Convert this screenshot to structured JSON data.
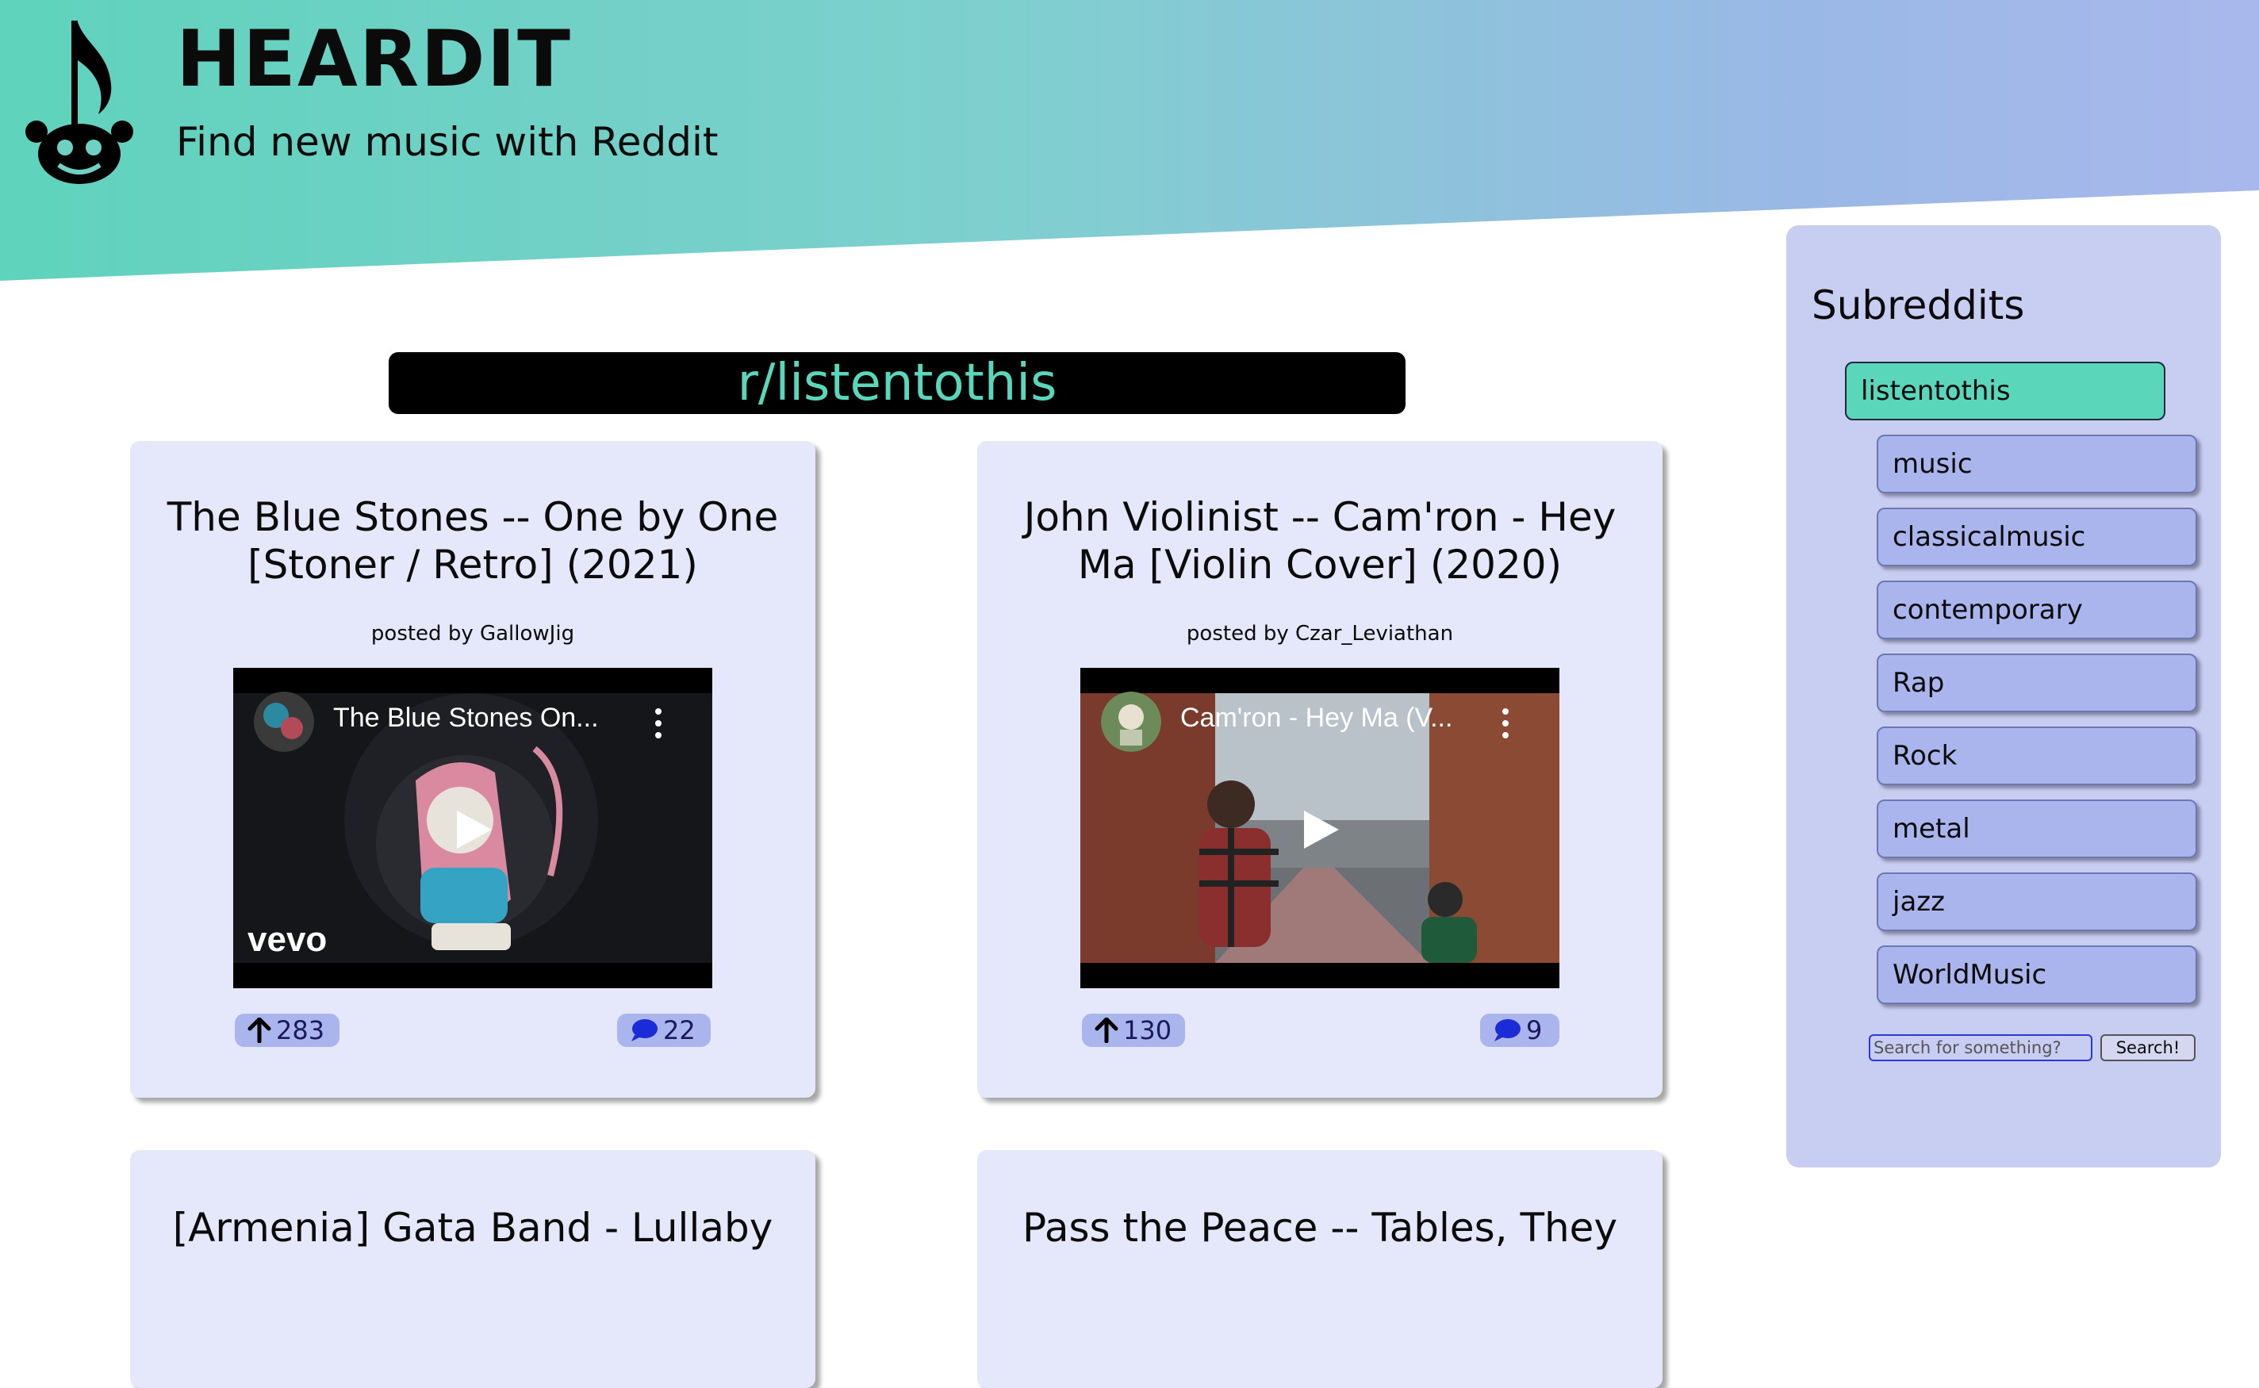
{
  "header": {
    "title": "HEARDIT",
    "subtitle": "Find new music with Reddit",
    "logo_icon": "music-note-reddit-logo-icon"
  },
  "main": {
    "current_subreddit": "r/listentothis",
    "posts": [
      {
        "title": "The Blue Stones -- One by One [Stoner / Retro] (2021)",
        "author": "posted by GallowJig",
        "video_title": "The Blue Stones On...",
        "video_brand": "vevo",
        "upvotes": "283",
        "comments": "22"
      },
      {
        "title": "John Violinist -- Cam'ron - Hey Ma [Violin Cover] (2020)",
        "author": "posted by Czar_Leviathan",
        "video_title": "Cam'ron - Hey Ma (V...",
        "upvotes": "130",
        "comments": "9"
      },
      {
        "title": "[Armenia] Gata Band - Lullaby"
      },
      {
        "title": "Pass the Peace -- Tables, They"
      }
    ]
  },
  "sidebar": {
    "title": "Subreddits",
    "items": [
      "listentothis",
      "music",
      "classicalmusic",
      "contemporary",
      "Rap",
      "Rock",
      "metal",
      "jazz",
      "WorldMusic"
    ],
    "active_item": "listentothis",
    "search_placeholder": "Search for something?",
    "search_button": "Search!"
  },
  "colors": {
    "accent": "#5ad6bb",
    "card_bg": "#e5e8fb",
    "pill_bg": "#a9b5ec",
    "sidebar_bg": "#c8cdf2"
  }
}
